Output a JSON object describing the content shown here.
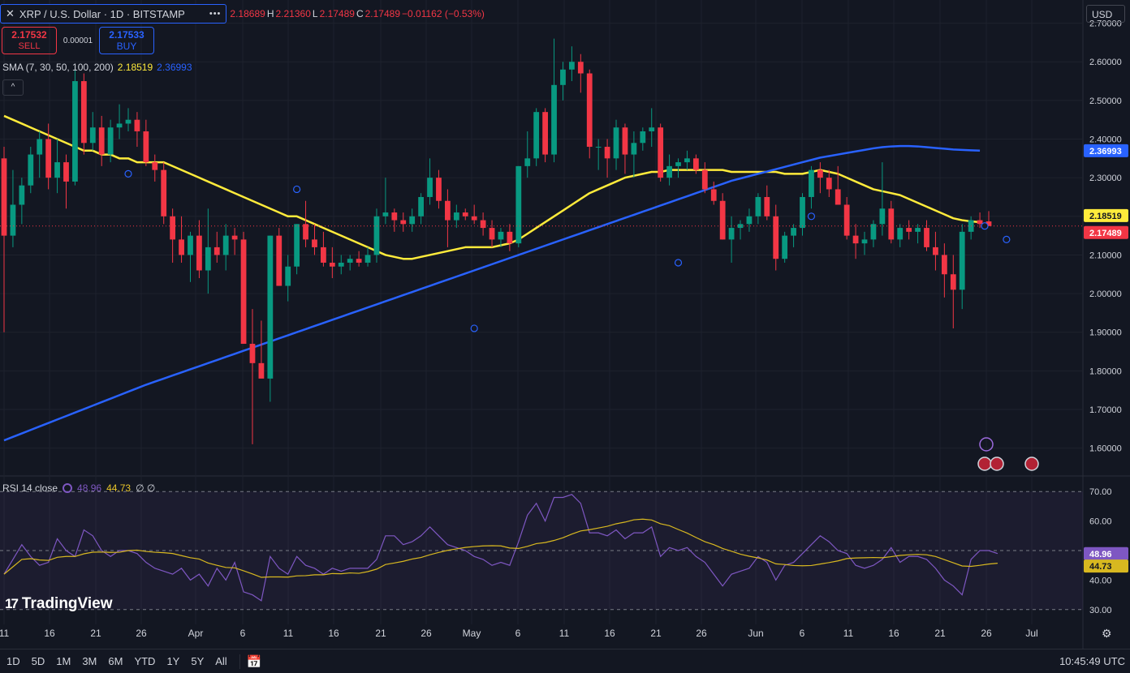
{
  "header": {
    "symbol_title": "XRP / U.S. Dollar · 1D · BITSTAMP",
    "ohlc": {
      "o_label": "O",
      "o": "2.18689",
      "h_label": "H",
      "h": "2.21360",
      "l_label": "L",
      "l": "2.17489",
      "c_label": "C",
      "c": "2.17489",
      "change": "−0.01162 (−0.53%)"
    }
  },
  "trade": {
    "sell_price": "2.17532",
    "sell_label": "SELL",
    "spread": "0.00001",
    "buy_price": "2.17533",
    "buy_label": "BUY"
  },
  "sma_legend": {
    "label": "SMA (7, 30, 50, 100, 200)",
    "v1": "2.18519",
    "v2": "2.36993"
  },
  "currency_button": "USD",
  "rsi_legend": {
    "label": "RSI 14 close",
    "v1": "48.96",
    "v2": "44.73",
    "extra": "∅ ∅"
  },
  "logo_text": "TradingView",
  "bottom_bar": {
    "ranges": [
      "1D",
      "5D",
      "1M",
      "3M",
      "6M",
      "YTD",
      "1Y",
      "5Y",
      "All"
    ],
    "clock": "10:45:49 UTC"
  },
  "colors": {
    "up": "#089981",
    "down": "#f23645",
    "sma_yellow": "#ffeb3b",
    "sma_blue": "#2962ff",
    "rsi": "#7e57c2",
    "rsi_ma": "#d8b820",
    "bg": "#131722"
  },
  "chart_data": {
    "type": "candlestick",
    "title": "XRP / U.S. Dollar · 1D · BITSTAMP",
    "price_axis": {
      "ticks": [
        "2.70000",
        "2.60000",
        "2.50000",
        "2.40000",
        "2.30000",
        "2.20000",
        "2.10000",
        "2.00000",
        "1.90000",
        "1.80000",
        "1.70000",
        "1.60000"
      ],
      "range": [
        1.53,
        2.76
      ]
    },
    "time_axis": [
      "11",
      "16",
      "21",
      "26",
      "Apr",
      "6",
      "11",
      "16",
      "21",
      "26",
      "May",
      "6",
      "11",
      "16",
      "21",
      "26",
      "Jun",
      "6",
      "11",
      "16",
      "21",
      "26",
      "Jul"
    ],
    "candles": [
      [
        2.35,
        2.38,
        1.9,
        2.15
      ],
      [
        2.15,
        2.32,
        2.12,
        2.23
      ],
      [
        2.23,
        2.3,
        2.18,
        2.28
      ],
      [
        2.28,
        2.38,
        2.26,
        2.36
      ],
      [
        2.36,
        2.42,
        2.3,
        2.4
      ],
      [
        2.4,
        2.44,
        2.27,
        2.3
      ],
      [
        2.3,
        2.4,
        2.26,
        2.34
      ],
      [
        2.34,
        2.36,
        2.22,
        2.29
      ],
      [
        2.29,
        2.58,
        2.28,
        2.55
      ],
      [
        2.55,
        2.57,
        2.36,
        2.39
      ],
      [
        2.39,
        2.47,
        2.37,
        2.43
      ],
      [
        2.43,
        2.46,
        2.33,
        2.36
      ],
      [
        2.36,
        2.45,
        2.34,
        2.43
      ],
      [
        2.43,
        2.49,
        2.4,
        2.44
      ],
      [
        2.44,
        2.48,
        2.42,
        2.45
      ],
      [
        2.45,
        2.47,
        2.38,
        2.42
      ],
      [
        2.42,
        2.45,
        2.33,
        2.34
      ],
      [
        2.34,
        2.36,
        2.29,
        2.32
      ],
      [
        2.32,
        2.34,
        2.18,
        2.2
      ],
      [
        2.2,
        2.22,
        2.08,
        2.14
      ],
      [
        2.14,
        2.2,
        2.08,
        2.1
      ],
      [
        2.1,
        2.16,
        2.03,
        2.15
      ],
      [
        2.15,
        2.19,
        2.04,
        2.06
      ],
      [
        2.06,
        2.22,
        2.0,
        2.12
      ],
      [
        2.12,
        2.16,
        2.08,
        2.1
      ],
      [
        2.1,
        2.18,
        2.06,
        2.15
      ],
      [
        2.15,
        2.17,
        2.1,
        2.14
      ],
      [
        2.14,
        2.16,
        1.88,
        1.87
      ],
      [
        1.87,
        1.96,
        1.61,
        1.82
      ],
      [
        1.82,
        1.93,
        1.79,
        1.78
      ],
      [
        1.78,
        2.15,
        1.72,
        2.15
      ],
      [
        2.15,
        2.17,
        2.02,
        2.02
      ],
      [
        2.02,
        2.1,
        1.98,
        2.07
      ],
      [
        2.07,
        2.18,
        2.05,
        2.18
      ],
      [
        2.18,
        2.24,
        2.12,
        2.14
      ],
      [
        2.14,
        2.18,
        2.1,
        2.12
      ],
      [
        2.12,
        2.16,
        2.07,
        2.08
      ],
      [
        2.08,
        2.12,
        2.04,
        2.07
      ],
      [
        2.07,
        2.1,
        2.05,
        2.08
      ],
      [
        2.08,
        2.1,
        2.06,
        2.09
      ],
      [
        2.09,
        2.11,
        2.07,
        2.08
      ],
      [
        2.08,
        2.12,
        2.07,
        2.1
      ],
      [
        2.1,
        2.22,
        2.08,
        2.2
      ],
      [
        2.2,
        2.3,
        2.18,
        2.21
      ],
      [
        2.21,
        2.22,
        2.16,
        2.19
      ],
      [
        2.19,
        2.21,
        2.16,
        2.18
      ],
      [
        2.18,
        2.22,
        2.16,
        2.2
      ],
      [
        2.2,
        2.26,
        2.18,
        2.25
      ],
      [
        2.25,
        2.35,
        2.23,
        2.3
      ],
      [
        2.3,
        2.32,
        2.22,
        2.24
      ],
      [
        2.24,
        2.27,
        2.12,
        2.19
      ],
      [
        2.19,
        2.23,
        2.17,
        2.21
      ],
      [
        2.21,
        2.22,
        2.19,
        2.2
      ],
      [
        2.2,
        2.23,
        2.18,
        2.19
      ],
      [
        2.19,
        2.21,
        2.15,
        2.17
      ],
      [
        2.17,
        2.19,
        2.12,
        2.14
      ],
      [
        2.14,
        2.17,
        2.12,
        2.16
      ],
      [
        2.16,
        2.18,
        2.11,
        2.13
      ],
      [
        2.13,
        2.33,
        2.12,
        2.33
      ],
      [
        2.33,
        2.42,
        2.3,
        2.35
      ],
      [
        2.35,
        2.48,
        2.33,
        2.47
      ],
      [
        2.47,
        2.48,
        2.34,
        2.36
      ],
      [
        2.36,
        2.66,
        2.34,
        2.54
      ],
      [
        2.54,
        2.6,
        2.5,
        2.58
      ],
      [
        2.58,
        2.64,
        2.55,
        2.6
      ],
      [
        2.6,
        2.62,
        2.52,
        2.57
      ],
      [
        2.57,
        2.58,
        2.35,
        2.38
      ],
      [
        2.38,
        2.4,
        2.32,
        2.38
      ],
      [
        2.38,
        2.4,
        2.3,
        2.35
      ],
      [
        2.35,
        2.45,
        2.32,
        2.43
      ],
      [
        2.43,
        2.44,
        2.31,
        2.36
      ],
      [
        2.36,
        2.42,
        2.3,
        2.39
      ],
      [
        2.39,
        2.43,
        2.37,
        2.42
      ],
      [
        2.42,
        2.48,
        2.38,
        2.43
      ],
      [
        2.43,
        2.44,
        2.29,
        2.3
      ],
      [
        2.3,
        2.36,
        2.28,
        2.33
      ],
      [
        2.33,
        2.35,
        2.3,
        2.34
      ],
      [
        2.34,
        2.37,
        2.32,
        2.35
      ],
      [
        2.35,
        2.36,
        2.31,
        2.32
      ],
      [
        2.32,
        2.34,
        2.26,
        2.27
      ],
      [
        2.27,
        2.29,
        2.23,
        2.24
      ],
      [
        2.24,
        2.26,
        2.14,
        2.14
      ],
      [
        2.14,
        2.2,
        2.08,
        2.17
      ],
      [
        2.17,
        2.19,
        2.14,
        2.18
      ],
      [
        2.18,
        2.22,
        2.16,
        2.2
      ],
      [
        2.2,
        2.26,
        2.18,
        2.25
      ],
      [
        2.25,
        2.28,
        2.19,
        2.2
      ],
      [
        2.2,
        2.23,
        2.06,
        2.09
      ],
      [
        2.09,
        2.16,
        2.08,
        2.15
      ],
      [
        2.15,
        2.18,
        2.12,
        2.17
      ],
      [
        2.17,
        2.26,
        2.15,
        2.25
      ],
      [
        2.25,
        2.33,
        2.22,
        2.32
      ],
      [
        2.32,
        2.34,
        2.26,
        2.3
      ],
      [
        2.3,
        2.32,
        2.25,
        2.27
      ],
      [
        2.27,
        2.33,
        2.24,
        2.23
      ],
      [
        2.23,
        2.25,
        2.14,
        2.15
      ],
      [
        2.15,
        2.18,
        2.09,
        2.13
      ],
      [
        2.13,
        2.16,
        2.1,
        2.14
      ],
      [
        2.14,
        2.19,
        2.12,
        2.18
      ],
      [
        2.18,
        2.34,
        2.15,
        2.22
      ],
      [
        2.22,
        2.24,
        2.13,
        2.14
      ],
      [
        2.14,
        2.18,
        2.12,
        2.17
      ],
      [
        2.17,
        2.19,
        2.14,
        2.16
      ],
      [
        2.16,
        2.18,
        2.13,
        2.17
      ],
      [
        2.17,
        2.19,
        2.11,
        2.12
      ],
      [
        2.12,
        2.16,
        2.06,
        2.1
      ],
      [
        2.1,
        2.13,
        1.99,
        2.05
      ],
      [
        2.05,
        2.1,
        1.91,
        2.01
      ],
      [
        2.01,
        2.18,
        1.96,
        2.16
      ],
      [
        2.16,
        2.2,
        2.14,
        2.19
      ],
      [
        2.19,
        2.21,
        2.17,
        2.18
      ],
      [
        2.18689,
        2.2136,
        2.17489,
        2.17489
      ]
    ],
    "series": [
      {
        "name": "SMA 30",
        "color": "#ffeb3b",
        "last": "2.18519",
        "values": [
          2.46,
          2.45,
          2.44,
          2.43,
          2.42,
          2.41,
          2.4,
          2.39,
          2.38,
          2.37,
          2.37,
          2.36,
          2.36,
          2.35,
          2.35,
          2.34,
          2.34,
          2.34,
          2.34,
          2.33,
          2.32,
          2.31,
          2.3,
          2.29,
          2.28,
          2.27,
          2.26,
          2.25,
          2.24,
          2.23,
          2.22,
          2.21,
          2.2,
          2.2,
          2.19,
          2.18,
          2.17,
          2.16,
          2.15,
          2.14,
          2.13,
          2.12,
          2.11,
          2.1,
          2.095,
          2.09,
          2.09,
          2.095,
          2.1,
          2.105,
          2.11,
          2.115,
          2.12,
          2.12,
          2.12,
          2.12,
          2.125,
          2.13,
          2.14,
          2.155,
          2.17,
          2.185,
          2.2,
          2.215,
          2.23,
          2.245,
          2.26,
          2.27,
          2.28,
          2.29,
          2.3,
          2.305,
          2.31,
          2.315,
          2.315,
          2.32,
          2.32,
          2.32,
          2.32,
          2.32,
          2.32,
          2.32,
          2.315,
          2.315,
          2.315,
          2.315,
          2.315,
          2.315,
          2.31,
          2.31,
          2.31,
          2.315,
          2.32,
          2.315,
          2.31,
          2.3,
          2.29,
          2.28,
          2.27,
          2.265,
          2.26,
          2.255,
          2.245,
          2.235,
          2.225,
          2.215,
          2.205,
          2.195,
          2.19,
          2.187,
          2.185
        ]
      },
      {
        "name": "SMA 200",
        "color": "#2962ff",
        "last": "2.36993",
        "values": [
          1.62,
          1.629,
          1.638,
          1.647,
          1.656,
          1.665,
          1.674,
          1.683,
          1.692,
          1.701,
          1.71,
          1.719,
          1.728,
          1.737,
          1.746,
          1.755,
          1.764,
          1.772,
          1.78,
          1.788,
          1.796,
          1.804,
          1.812,
          1.82,
          1.828,
          1.836,
          1.844,
          1.852,
          1.86,
          1.868,
          1.876,
          1.884,
          1.892,
          1.9,
          1.908,
          1.916,
          1.924,
          1.932,
          1.94,
          1.948,
          1.956,
          1.964,
          1.972,
          1.98,
          1.988,
          1.996,
          2.004,
          2.012,
          2.02,
          2.028,
          2.036,
          2.044,
          2.052,
          2.06,
          2.068,
          2.076,
          2.084,
          2.092,
          2.1,
          2.108,
          2.116,
          2.124,
          2.132,
          2.14,
          2.148,
          2.156,
          2.164,
          2.172,
          2.18,
          2.188,
          2.196,
          2.204,
          2.212,
          2.22,
          2.228,
          2.236,
          2.244,
          2.252,
          2.26,
          2.268,
          2.276,
          2.284,
          2.292,
          2.298,
          2.304,
          2.31,
          2.316,
          2.322,
          2.328,
          2.334,
          2.34,
          2.346,
          2.352,
          2.356,
          2.36,
          2.364,
          2.368,
          2.372,
          2.376,
          2.379,
          2.381,
          2.382,
          2.382,
          2.381,
          2.379,
          2.377,
          2.375,
          2.373,
          2.372,
          2.371,
          2.37
        ]
      }
    ],
    "last_price": "2.17489",
    "rsi": {
      "axis_ticks": [
        "70.00",
        "60.00",
        "50.00",
        "40.00",
        "30.00"
      ],
      "upper": 70,
      "lower": 30,
      "last_rsi": "48.96",
      "last_ma": "44.73",
      "rsi_values": [
        42,
        47,
        52,
        48,
        45,
        46,
        54,
        50,
        48,
        57,
        55,
        50,
        48,
        50,
        50,
        49,
        46,
        44,
        43,
        42,
        44,
        40,
        42,
        38,
        44,
        40,
        46,
        36,
        35,
        33,
        48,
        44,
        42,
        48,
        45,
        44,
        42,
        44,
        43,
        44,
        44,
        44,
        47,
        55,
        55,
        52,
        53,
        55,
        58,
        55,
        52,
        51,
        50,
        48,
        47,
        45,
        46,
        45,
        53,
        62,
        66,
        60,
        68,
        68,
        69,
        66,
        56,
        56,
        55,
        57,
        54,
        56,
        56,
        58,
        48,
        51,
        50,
        51,
        48,
        46,
        42,
        38,
        42,
        43,
        44,
        48,
        46,
        40,
        45,
        46,
        49,
        52,
        55,
        53,
        50,
        49,
        45,
        44,
        45,
        47,
        51,
        46,
        48,
        48,
        47,
        44,
        40,
        38,
        35,
        47,
        50,
        50,
        49
      ]
    }
  }
}
